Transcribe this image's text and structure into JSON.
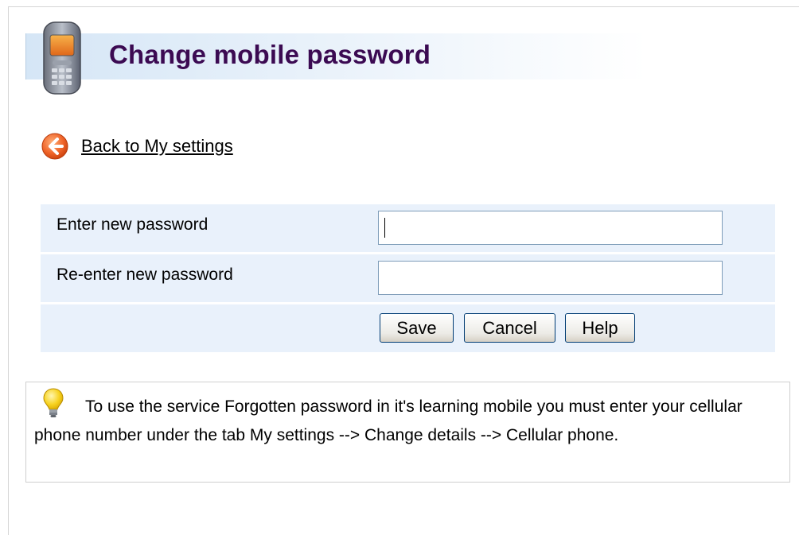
{
  "page": {
    "title": "Change mobile password",
    "back_link": "Back to My settings"
  },
  "form": {
    "new_password_label": "Enter new password",
    "new_password_value": "",
    "reenter_password_label": "Re-enter new password",
    "reenter_password_value": "",
    "save_label": "Save",
    "cancel_label": "Cancel",
    "help_label": "Help"
  },
  "tip": {
    "text": "To use the service Forgotten password in it's learning mobile you must enter your cellular phone number under the tab My settings --> Change details --> Cellular phone."
  },
  "icons": {
    "title_icon": "mobile-phone-icon",
    "back_icon": "back-arrow-icon",
    "tip_icon": "lightbulb-icon"
  },
  "colors": {
    "title": "#3b0a52",
    "form_row_bg": "#e9f1fb",
    "back_icon": "#e8571c"
  }
}
